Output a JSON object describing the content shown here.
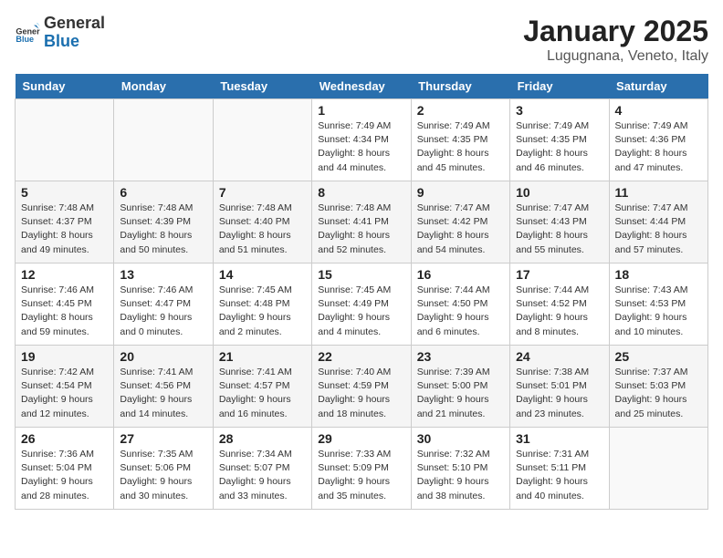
{
  "header": {
    "logo_general": "General",
    "logo_blue": "Blue",
    "title": "January 2025",
    "subtitle": "Lugugnana, Veneto, Italy"
  },
  "weekdays": [
    "Sunday",
    "Monday",
    "Tuesday",
    "Wednesday",
    "Thursday",
    "Friday",
    "Saturday"
  ],
  "weeks": [
    [
      {
        "day": null,
        "info": null
      },
      {
        "day": null,
        "info": null
      },
      {
        "day": null,
        "info": null
      },
      {
        "day": "1",
        "info": "Sunrise: 7:49 AM\nSunset: 4:34 PM\nDaylight: 8 hours\nand 44 minutes."
      },
      {
        "day": "2",
        "info": "Sunrise: 7:49 AM\nSunset: 4:35 PM\nDaylight: 8 hours\nand 45 minutes."
      },
      {
        "day": "3",
        "info": "Sunrise: 7:49 AM\nSunset: 4:35 PM\nDaylight: 8 hours\nand 46 minutes."
      },
      {
        "day": "4",
        "info": "Sunrise: 7:49 AM\nSunset: 4:36 PM\nDaylight: 8 hours\nand 47 minutes."
      }
    ],
    [
      {
        "day": "5",
        "info": "Sunrise: 7:48 AM\nSunset: 4:37 PM\nDaylight: 8 hours\nand 49 minutes."
      },
      {
        "day": "6",
        "info": "Sunrise: 7:48 AM\nSunset: 4:39 PM\nDaylight: 8 hours\nand 50 minutes."
      },
      {
        "day": "7",
        "info": "Sunrise: 7:48 AM\nSunset: 4:40 PM\nDaylight: 8 hours\nand 51 minutes."
      },
      {
        "day": "8",
        "info": "Sunrise: 7:48 AM\nSunset: 4:41 PM\nDaylight: 8 hours\nand 52 minutes."
      },
      {
        "day": "9",
        "info": "Sunrise: 7:47 AM\nSunset: 4:42 PM\nDaylight: 8 hours\nand 54 minutes."
      },
      {
        "day": "10",
        "info": "Sunrise: 7:47 AM\nSunset: 4:43 PM\nDaylight: 8 hours\nand 55 minutes."
      },
      {
        "day": "11",
        "info": "Sunrise: 7:47 AM\nSunset: 4:44 PM\nDaylight: 8 hours\nand 57 minutes."
      }
    ],
    [
      {
        "day": "12",
        "info": "Sunrise: 7:46 AM\nSunset: 4:45 PM\nDaylight: 8 hours\nand 59 minutes."
      },
      {
        "day": "13",
        "info": "Sunrise: 7:46 AM\nSunset: 4:47 PM\nDaylight: 9 hours\nand 0 minutes."
      },
      {
        "day": "14",
        "info": "Sunrise: 7:45 AM\nSunset: 4:48 PM\nDaylight: 9 hours\nand 2 minutes."
      },
      {
        "day": "15",
        "info": "Sunrise: 7:45 AM\nSunset: 4:49 PM\nDaylight: 9 hours\nand 4 minutes."
      },
      {
        "day": "16",
        "info": "Sunrise: 7:44 AM\nSunset: 4:50 PM\nDaylight: 9 hours\nand 6 minutes."
      },
      {
        "day": "17",
        "info": "Sunrise: 7:44 AM\nSunset: 4:52 PM\nDaylight: 9 hours\nand 8 minutes."
      },
      {
        "day": "18",
        "info": "Sunrise: 7:43 AM\nSunset: 4:53 PM\nDaylight: 9 hours\nand 10 minutes."
      }
    ],
    [
      {
        "day": "19",
        "info": "Sunrise: 7:42 AM\nSunset: 4:54 PM\nDaylight: 9 hours\nand 12 minutes."
      },
      {
        "day": "20",
        "info": "Sunrise: 7:41 AM\nSunset: 4:56 PM\nDaylight: 9 hours\nand 14 minutes."
      },
      {
        "day": "21",
        "info": "Sunrise: 7:41 AM\nSunset: 4:57 PM\nDaylight: 9 hours\nand 16 minutes."
      },
      {
        "day": "22",
        "info": "Sunrise: 7:40 AM\nSunset: 4:59 PM\nDaylight: 9 hours\nand 18 minutes."
      },
      {
        "day": "23",
        "info": "Sunrise: 7:39 AM\nSunset: 5:00 PM\nDaylight: 9 hours\nand 21 minutes."
      },
      {
        "day": "24",
        "info": "Sunrise: 7:38 AM\nSunset: 5:01 PM\nDaylight: 9 hours\nand 23 minutes."
      },
      {
        "day": "25",
        "info": "Sunrise: 7:37 AM\nSunset: 5:03 PM\nDaylight: 9 hours\nand 25 minutes."
      }
    ],
    [
      {
        "day": "26",
        "info": "Sunrise: 7:36 AM\nSunset: 5:04 PM\nDaylight: 9 hours\nand 28 minutes."
      },
      {
        "day": "27",
        "info": "Sunrise: 7:35 AM\nSunset: 5:06 PM\nDaylight: 9 hours\nand 30 minutes."
      },
      {
        "day": "28",
        "info": "Sunrise: 7:34 AM\nSunset: 5:07 PM\nDaylight: 9 hours\nand 33 minutes."
      },
      {
        "day": "29",
        "info": "Sunrise: 7:33 AM\nSunset: 5:09 PM\nDaylight: 9 hours\nand 35 minutes."
      },
      {
        "day": "30",
        "info": "Sunrise: 7:32 AM\nSunset: 5:10 PM\nDaylight: 9 hours\nand 38 minutes."
      },
      {
        "day": "31",
        "info": "Sunrise: 7:31 AM\nSunset: 5:11 PM\nDaylight: 9 hours\nand 40 minutes."
      },
      {
        "day": null,
        "info": null
      }
    ]
  ]
}
